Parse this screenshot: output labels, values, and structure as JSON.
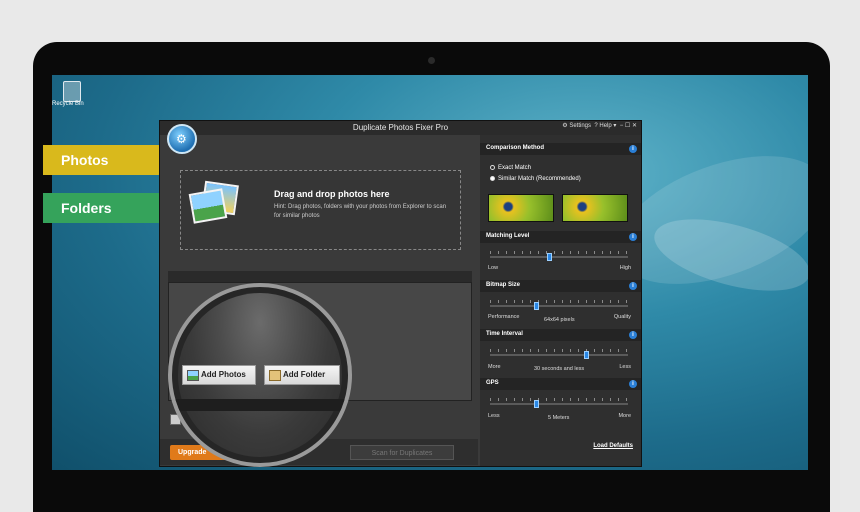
{
  "desktop": {
    "recycle_label": "Recycle Bin",
    "tabs": [
      {
        "label": "Photos",
        "color": "#d9b91c"
      },
      {
        "label": "Folders",
        "color": "#35a35b"
      }
    ]
  },
  "window": {
    "title": "Duplicate Photos Fixer Pro",
    "settings": "⚙ Settings",
    "help": "? Help ▾",
    "controls": "−  ☐  ✕"
  },
  "dropzone": {
    "title": "Drag and drop photos here",
    "hint": "Hint: Drag photos, folders with your photos from Explorer to scan for similar photos"
  },
  "buttons": {
    "add_photos": "Add Photos",
    "add_folder": "Add Folder",
    "upgrade": "Upgrade",
    "scan": "Scan for Duplicates"
  },
  "panel": {
    "comparison": {
      "title": "Comparison Method",
      "options": [
        "Exact Match",
        "Similar Match (Recommended)"
      ],
      "selected": 1
    },
    "matching": {
      "title": "Matching Level",
      "min": "Low",
      "max": "High"
    },
    "bitmap": {
      "title": "Bitmap Size",
      "min": "Performance",
      "max": "Quality",
      "value": "64x64 pixels"
    },
    "time": {
      "title": "Time Interval",
      "min": "More",
      "max": "Less",
      "value": "30 seconds and less"
    },
    "gps": {
      "title": "GPS",
      "min": "Less",
      "max": "More",
      "value": "5 Meters"
    },
    "load_defaults": "Load Defaults",
    "info_glyph": "i"
  },
  "colors": {
    "accent": "#2a88e6",
    "upgrade": "#e07a1a"
  }
}
